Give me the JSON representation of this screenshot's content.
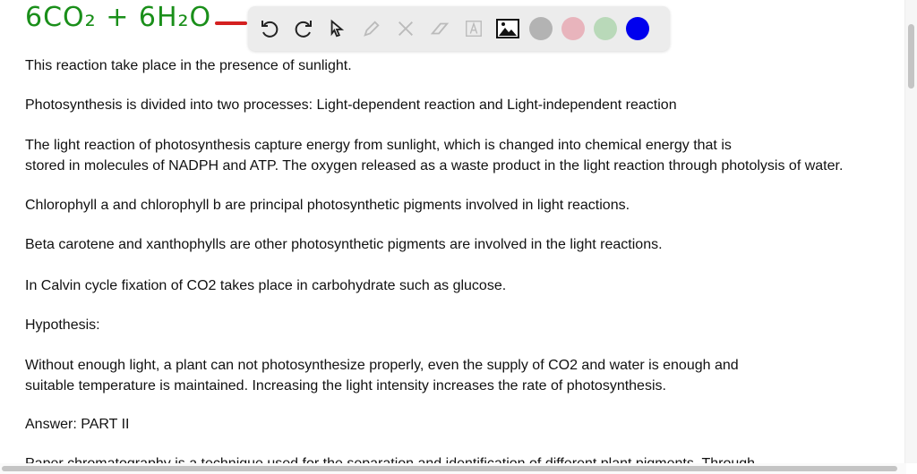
{
  "handwriting": {
    "equation": "6CO₂ + 6H₂O"
  },
  "toolbar": {
    "tools": [
      "undo-icon",
      "redo-icon",
      "pointer-icon",
      "pencil-icon",
      "tools-icon",
      "eraser-icon",
      "text-icon",
      "image-icon"
    ],
    "colors": [
      "#b3b3b3",
      "#e8b4bc",
      "#b9d9b9",
      "#0000ee"
    ]
  },
  "content": {
    "p1": "This reaction take place in the presence of sunlight.",
    "p2": "Photosynthesis is divided into two processes: Light-dependent reaction and Light-independent reaction",
    "p3a": "The light reaction of photosynthesis capture energy from sunlight, which is changed into chemical energy that is",
    "p3b": " stored in molecules of NADPH and ATP. The oxygen released as a waste product in the light reaction through photolysis of water.",
    "p4": "Chlorophyll a and chlorophyll b are principal photosynthetic pigments involved in light reactions.",
    "p5": "Beta carotene and xanthophylls are other photosynthetic pigments are involved in the light reactions.",
    "p6": "In Calvin cycle fixation of CO2 takes place in carbohydrate such as glucose.",
    "p7": "Hypothesis:",
    "p8a": "Without enough light, a plant can not photosynthesize properly, even the supply of CO2 and water is enough and",
    "p8b": "suitable temperature is maintained. Increasing the light intensity increases the rate of photosynthesis.",
    "p9": "Answer: PART II",
    "p10": "Paper chromatography is a technique used for the separation and identification of different plant pigments. Through"
  }
}
